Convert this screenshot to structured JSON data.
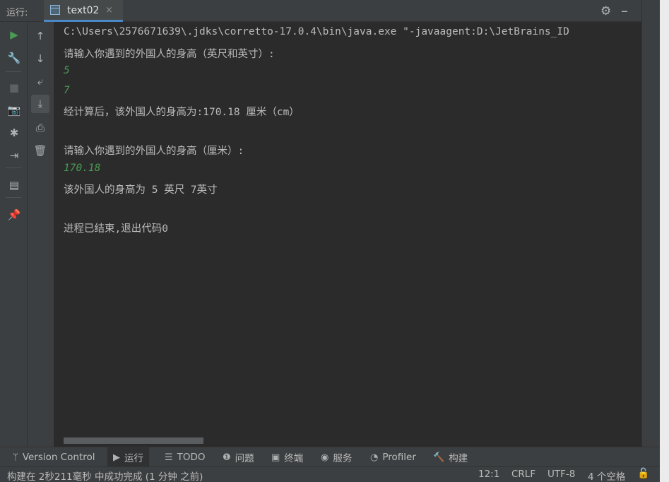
{
  "run_panel": {
    "label": "运行:",
    "tab_name": "text02",
    "tab_close": "×",
    "settings_icon": "gear-icon",
    "minimize_icon": "minimize-icon"
  },
  "left_toolbar": [
    {
      "name": "rerun-icon",
      "glyph": "▶",
      "color": "#499c54"
    },
    {
      "name": "wrench-icon",
      "glyph": "🔧"
    },
    {
      "name": "stop-icon",
      "glyph": "■",
      "color": "#5e6163"
    },
    {
      "name": "camera-icon",
      "glyph": "📷"
    },
    {
      "name": "debug-icon",
      "glyph": "✱"
    },
    {
      "name": "exit-icon",
      "glyph": "⇥"
    },
    {
      "name": "layout-icon",
      "glyph": "▤"
    },
    {
      "name": "pin-icon",
      "glyph": "📌"
    }
  ],
  "second_toolbar": [
    {
      "name": "up-arrow-icon",
      "glyph": "↑"
    },
    {
      "name": "down-arrow-icon",
      "glyph": "↓"
    },
    {
      "name": "soft-wrap-icon",
      "glyph": "⤶"
    },
    {
      "name": "scroll-to-end-icon",
      "glyph": "⤓",
      "active": true
    },
    {
      "name": "print-icon",
      "glyph": "⎙"
    },
    {
      "name": "trash-icon",
      "glyph": "🗑"
    }
  ],
  "console_lines": [
    {
      "text": "C:\\Users\\2576671639\\.jdks\\corretto-17.0.4\\bin\\java.exe \"-javaagent:D:\\JetBrains_ID",
      "type": "output"
    },
    {
      "text": "请输入你遇到的外国人的身高（英尺和英寸）:",
      "type": "output"
    },
    {
      "text": "5",
      "type": "input"
    },
    {
      "text": "7",
      "type": "input"
    },
    {
      "text": "经计算后，该外国人的身高为:170.18 厘米（cm）",
      "type": "output"
    },
    {
      "text": "",
      "type": "output"
    },
    {
      "text": "请输入你遇到的外国人的身高（厘米）:",
      "type": "output"
    },
    {
      "text": "170.18",
      "type": "input"
    },
    {
      "text": "该外国人的身高为 5 英尺 7英寸",
      "type": "output"
    },
    {
      "text": "",
      "type": "output"
    },
    {
      "text": "进程已结束,退出代码0",
      "type": "output"
    }
  ],
  "tool_windows": [
    {
      "label": "Version Control",
      "icon": "branch-icon",
      "glyph": "ᛘ"
    },
    {
      "label": "运行",
      "icon": "run-icon",
      "glyph": "▶",
      "active": true
    },
    {
      "label": "TODO",
      "icon": "list-icon",
      "glyph": "☰"
    },
    {
      "label": "问题",
      "icon": "problems-icon",
      "glyph": "❶"
    },
    {
      "label": "终端",
      "icon": "terminal-icon",
      "glyph": "▣"
    },
    {
      "label": "服务",
      "icon": "services-icon",
      "glyph": "◉"
    },
    {
      "label": "Profiler",
      "icon": "profiler-icon",
      "glyph": "◔"
    },
    {
      "label": "构建",
      "icon": "hammer-icon",
      "glyph": "🔨"
    }
  ],
  "status": {
    "message": "构建在 2秒211毫秒 中成功完成 (1 分钟 之前)",
    "position": "12:1",
    "line_sep": "CRLF",
    "encoding": "UTF-8",
    "indent": "4 个空格",
    "lock_icon": "unlock-icon"
  }
}
